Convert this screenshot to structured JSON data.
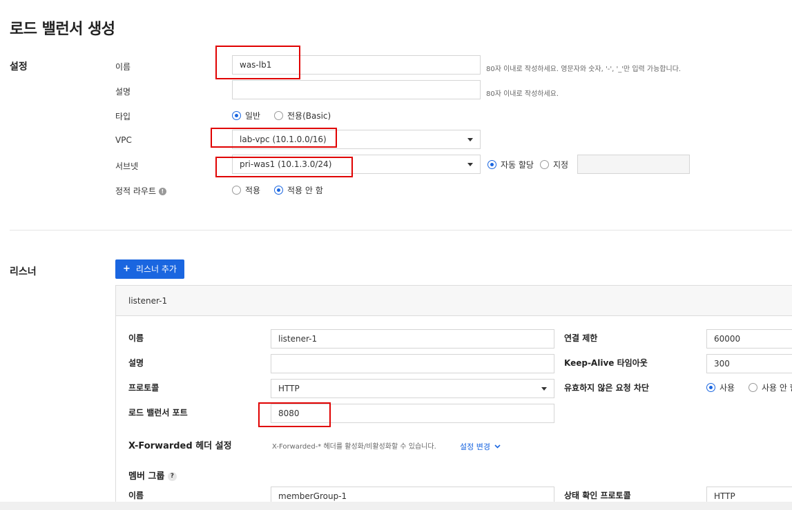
{
  "page": {
    "title": "로드 밸런서 생성"
  },
  "settings": {
    "section_title": "설정",
    "name_label": "이름",
    "name_value": "was-lb1",
    "name_hint": "80자 이내로 작성하세요. 영문자와 숫자, '-', '_'만 입력 가능합니다.",
    "desc_label": "설명",
    "desc_value": "",
    "desc_hint": "80자 이내로 작성하세요.",
    "type_label": "타입",
    "type_options": [
      "일반",
      "전용(Basic)"
    ],
    "type_selected": "일반",
    "vpc_label": "VPC",
    "vpc_value": "lab-vpc (10.1.0.0/16)",
    "subnet_label": "서브넷",
    "subnet_value": "pri-was1 (10.1.3.0/24)",
    "ip_options": [
      "자동 할당",
      "지정"
    ],
    "ip_selected": "자동 할당",
    "ip_value": "",
    "static_route_label": "정적 라우트",
    "static_route_options": [
      "적용",
      "적용 안 함"
    ],
    "static_route_selected": "적용 안 함"
  },
  "listener": {
    "section_title": "리스너",
    "add_button_icon": "+",
    "add_button_label": "리스너 추가",
    "panel_title": "listener-1",
    "name_label": "이름",
    "name_value": "listener-1",
    "desc_label": "설명",
    "desc_value": "",
    "protocol_label": "프로토콜",
    "protocol_value": "HTTP",
    "port_label": "로드 밸런서 포트",
    "port_value": "8080",
    "conn_limit_label": "연결 제한",
    "conn_limit_value": "60000",
    "keepalive_label": "Keep-Alive 타임아웃",
    "keepalive_value": "300",
    "block_invalid_label": "유효하지 않은 요청 차단",
    "block_options": [
      "사용",
      "사용 안 함"
    ],
    "block_selected": "사용",
    "xff_label": "X-Forwarded 헤더 설정",
    "xff_hint": "X-Forwarded-* 헤더를 활성화/비활성화할 수 있습니다.",
    "xff_link": "설정 변경",
    "member_group_label": "멤버 그룹",
    "member_name_label": "이름",
    "member_name_value": "memberGroup-1",
    "health_protocol_label": "상태 확인 프로토콜",
    "health_protocol_value": "HTTP"
  },
  "colors": {
    "accent": "#1a66e0",
    "highlight_box": "#e00000"
  }
}
